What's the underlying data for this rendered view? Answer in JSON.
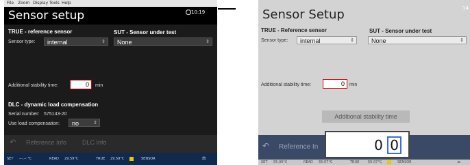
{
  "menu": [
    "File",
    "Zoom",
    "Display",
    "Tools",
    "Help"
  ],
  "left": {
    "title": "Sensor setup",
    "clock": "10:19",
    "true_heading": "TRUE - reference sensor",
    "sut_heading": "SUT - Sensor under test",
    "sensor_type_label": "Sensor type:",
    "sensor_type_value": "internal",
    "sut_value": "None",
    "stability_label": "Additional stability time:",
    "stability_value": "0",
    "stability_unit": "min",
    "dlc_heading": "DLC - dynamic load compensation",
    "serial_label": "Serial number:",
    "serial_value": "575143-20",
    "load_comp_label": "Use load compensation:",
    "load_comp_value": "no",
    "btn_ref_info": "Reference Info",
    "btn_dlc_info": "DLC Info",
    "status": {
      "set_label": "SET",
      "set_value": "---.-- °C",
      "read_label": "READ",
      "read_value": "29.59°C",
      "true_label": "TRUE",
      "true_value": "29.59°C",
      "sensor_label": "SENSOR"
    }
  },
  "right": {
    "title": "Sensor Setup",
    "clock": "14:3",
    "true_heading": "TRUE - Reference sensor",
    "sut_heading": "SUT - Sensor under test",
    "sensor_type_label": "Sensor type:",
    "sensor_type_value": "internal",
    "sut_value": "None",
    "stability_label": "Additional stability time:",
    "stability_value": "0",
    "stability_unit": "min",
    "popup_title": "Additional stability time",
    "popup_digit_1": "0",
    "popup_digit_2": "0",
    "btn_ref_info": "Reference In",
    "status": {
      "set_label": "SET",
      "set_value": "55.00°C",
      "read_label": "READ",
      "read_value": "55.07°C",
      "true_label": "TRUE",
      "true_value": "55.07°C",
      "sensor_label": "SENSOR"
    }
  },
  "colors": {
    "dark_bg": "#000000",
    "statusbar_blue": "#0f2a4d",
    "input_border_red": "#cc0000",
    "indicator_yellow": "#f2c500",
    "light_bg": "#d3d3d3"
  }
}
